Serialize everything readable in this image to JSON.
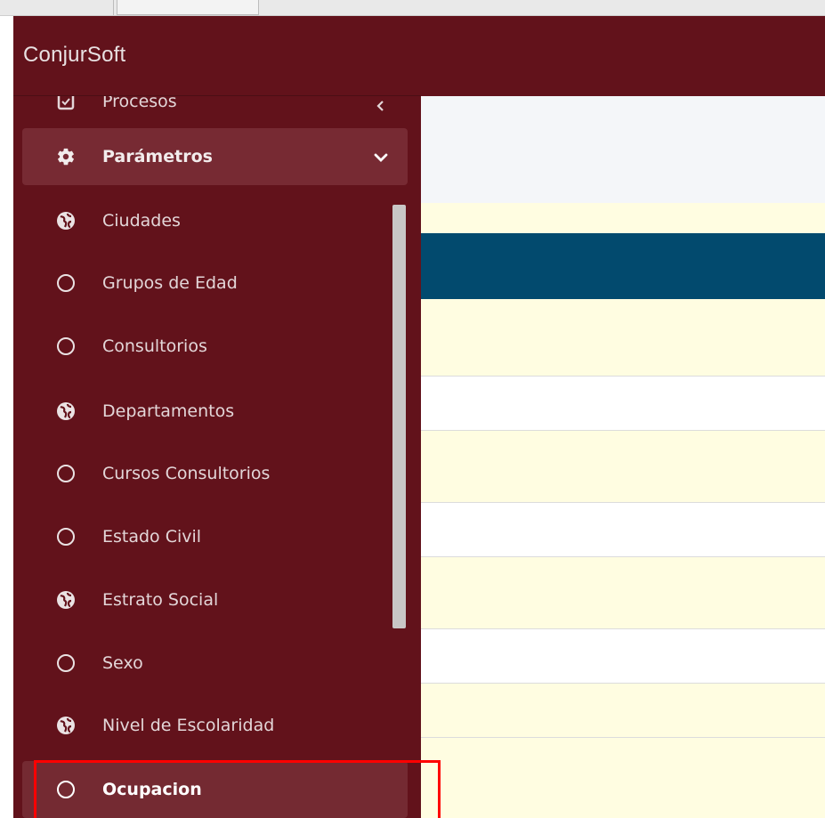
{
  "brand": {
    "name": "ConjurSoft"
  },
  "colors": {
    "sidebar_bg": "#62121b",
    "sidebar_active_bg": "#772a33",
    "content_header": "#024a6e",
    "content_cream": "#fffde1",
    "highlight": "#ff0000"
  },
  "sidebar": {
    "parent_partial": {
      "label": "Procesos",
      "icon": "file-icon"
    },
    "parent": {
      "label": "Parámetros",
      "icon": "gear-icon",
      "expanded": true
    },
    "items": [
      {
        "label": "Ciudades",
        "icon": "globe-icon"
      },
      {
        "label": "Grupos de Edad",
        "icon": "circle-icon"
      },
      {
        "label": "Consultorios",
        "icon": "circle-icon"
      },
      {
        "label": "Departamentos",
        "icon": "globe-icon"
      },
      {
        "label": "Cursos Consultorios",
        "icon": "circle-icon"
      },
      {
        "label": "Estado Civil",
        "icon": "circle-icon"
      },
      {
        "label": "Estrato Social",
        "icon": "globe-icon"
      },
      {
        "label": "Sexo",
        "icon": "circle-icon"
      },
      {
        "label": "Nivel de Escolaridad",
        "icon": "globe-icon"
      },
      {
        "label": "Ocupacion",
        "icon": "circle-icon",
        "active": true,
        "highlighted": true
      }
    ]
  }
}
